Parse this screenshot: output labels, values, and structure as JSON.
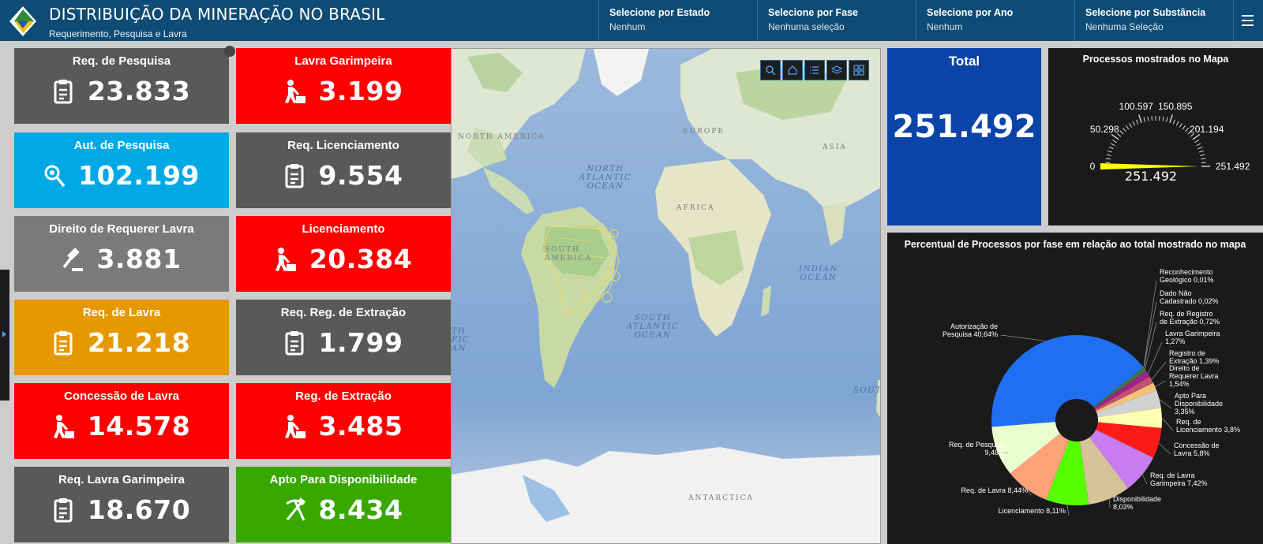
{
  "header": {
    "title": "DISTRIBUIÇÃO DA MINERAÇÃO NO BRASIL",
    "subtitle": "Requerimento, Pesquisa e Lavra",
    "selectors": [
      {
        "label": "Selecione por Estado",
        "value": "Nenhum"
      },
      {
        "label": "Selecione por Fase",
        "value": "Nenhuma seleção"
      },
      {
        "label": "Selecione por Ano",
        "value": "Nenhum"
      },
      {
        "label": "Selecione por Substância",
        "value": "Nenhuma Seleção"
      }
    ]
  },
  "tiles": [
    {
      "label": "Req. de Pesquisa",
      "value": "23.833",
      "color": "#595959",
      "icon": "clipboard-icon"
    },
    {
      "label": "Lavra Garimpeira",
      "value": "3.199",
      "color": "#ff0000",
      "icon": "miner-icon"
    },
    {
      "label": "Aut. de Pesquisa",
      "value": "102.199",
      "color": "#00a9e6",
      "icon": "search-location-icon"
    },
    {
      "label": "Req. Licenciamento",
      "value": "9.554",
      "color": "#595959",
      "icon": "clipboard-icon"
    },
    {
      "label": "Direito de Requerer Lavra",
      "value": "3.881",
      "color": "#7a7a7a",
      "icon": "gavel-icon"
    },
    {
      "label": "Licenciamento",
      "value": "20.384",
      "color": "#ff0000",
      "icon": "miner-icon"
    },
    {
      "label": "Req. de Lavra",
      "value": "21.218",
      "color": "#e69800",
      "icon": "clipboard-icon"
    },
    {
      "label": "Req. Reg. de Extração",
      "value": "1.799",
      "color": "#595959",
      "icon": "clipboard-icon"
    },
    {
      "label": "Concessão de Lavra",
      "value": "14.578",
      "color": "#ff0000",
      "icon": "miner-icon"
    },
    {
      "label": "Reg. de Extração",
      "value": "3.485",
      "color": "#ff0000",
      "icon": "miner-icon"
    },
    {
      "label": "Req. Lavra Garimpeira",
      "value": "18.670",
      "color": "#595959",
      "icon": "clipboard-icon"
    },
    {
      "label": "Apto Para Disponibilidade",
      "value": "8.434",
      "color": "#38a800",
      "icon": "pickaxe-hammer-icon"
    }
  ],
  "map": {
    "tools": [
      "search-icon",
      "home-icon",
      "legend-icon",
      "layers-icon",
      "basemap-icon"
    ],
    "labels": {
      "north_america": "NORTH AMERICA",
      "europe": "EUROPE",
      "asia": "ASIA",
      "africa": "AFRICA",
      "south_america": "SOUTH AMERICA",
      "antarctica": "ANTARCTICA",
      "north_atlantic": "NORTH ATLANTIC OCEAN",
      "south_atlantic": "SOUTH ATLANTIC OCEAN",
      "indian": "INDIAN OCEAN",
      "pacific_frag": "TH FIC AN",
      "south_frag": "SOUTH"
    }
  },
  "total": {
    "label": "Total",
    "value": "251.492"
  },
  "gauge": {
    "title": "Processos mostrados no Mapa",
    "min": 0,
    "max": 251492,
    "value": 251492,
    "value_label": "251.492",
    "min_label": "0",
    "max_label": "251.492",
    "ticks": [
      "50.298",
      "100.597",
      "150.895",
      "201.194"
    ],
    "needle_color": "#ffff00"
  },
  "pie": {
    "title": "Percentual de Processos por fase em relação ao total mostrado no mapa"
  },
  "chart_data": {
    "type": "pie",
    "title": "Percentual de Processos por fase em relação ao total mostrado no mapa",
    "donut": true,
    "slices": [
      {
        "label": "Autorização de Pesquisa 40,64%",
        "value": 40.64,
        "color": "#1f6ff0"
      },
      {
        "label": "Reconhecimento Geológico 0,01%",
        "value": 0.01,
        "color": "#9e9e9e"
      },
      {
        "label": "Dado Não Cadastrado 0,02%",
        "value": 0.02,
        "color": "#4a7a2a"
      },
      {
        "label": "Req. de Registro de Extração 0,72%",
        "value": 0.72,
        "color": "#3a7a3a"
      },
      {
        "label": "Lavra Garimpeira 1,27%",
        "value": 1.27,
        "color": "#a0208a"
      },
      {
        "label": "Registro de Extração 1,39%",
        "value": 1.39,
        "color": "#c05070"
      },
      {
        "label": "Direito de Requerer Lavra 1,54%",
        "value": 1.54,
        "color": "#f2c27a"
      },
      {
        "label": "Apto Para Disponibilidade 3,35%",
        "value": 3.35,
        "color": "#d2d2d2"
      },
      {
        "label": "Req. de Licenciamento 3,8%",
        "value": 3.8,
        "color": "#ffffb0"
      },
      {
        "label": "Concessão de Lavra 5,8%",
        "value": 5.8,
        "color": "#ff1a1a"
      },
      {
        "label": "Req. de Lavra Garimpeira 7,42%",
        "value": 7.42,
        "color": "#c87cf0"
      },
      {
        "label": "Disponibilidade 8,03%",
        "value": 8.03,
        "color": "#d8c29a"
      },
      {
        "label": "Licenciamento 8,11%",
        "value": 8.11,
        "color": "#55ff00"
      },
      {
        "label": "Req. de Lavra 8,44%",
        "value": 8.44,
        "color": "#ffa27a"
      },
      {
        "label": "Req. de Pesquisa 9,48%",
        "value": 9.48,
        "color": "#eaffd0"
      }
    ]
  }
}
